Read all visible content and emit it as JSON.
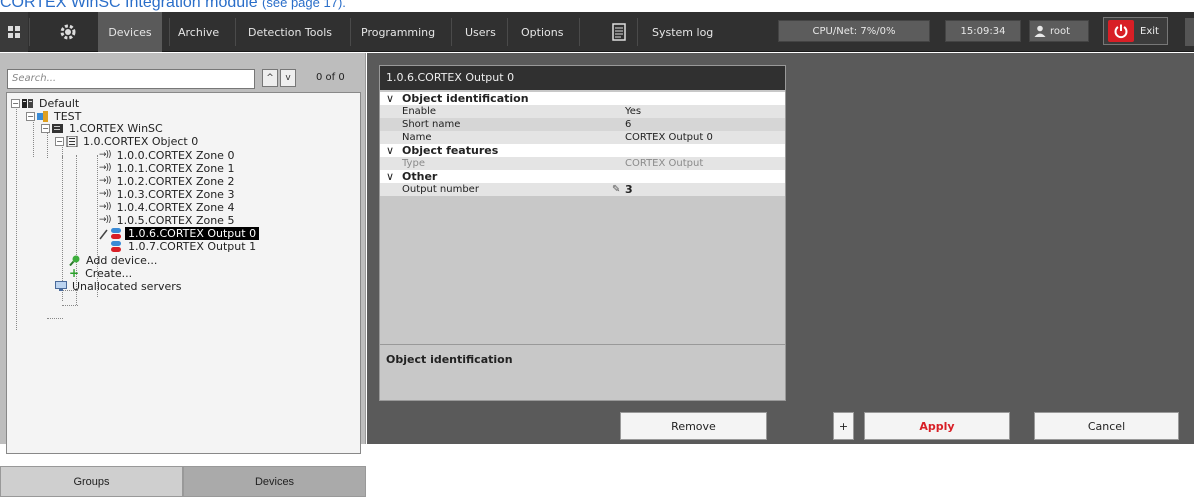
{
  "doc": {
    "caption": "CORTEX WinSC Integration module",
    "page_ref": "(see page 17)."
  },
  "topbar": {
    "tabs": [
      "Devices",
      "Archive",
      "Detection Tools",
      "Programming",
      "Users",
      "Options",
      "System log"
    ],
    "active_tab": "Devices",
    "cpu_net": "CPU/Net: 7%/0%",
    "clock": "15:09:34",
    "user": "root",
    "exit_label": "Exit",
    "colors": {
      "bar": "#303030",
      "exit": "#d81f26"
    }
  },
  "search": {
    "placeholder": "Search...",
    "count": "0 of 0",
    "up": "^",
    "down": "v"
  },
  "tree": {
    "root": "Default",
    "test": "TEST",
    "server": "1.CORTEX WinSC",
    "object": "1.0.CORTEX Object 0",
    "zones": [
      "1.0.0.CORTEX Zone 0",
      "1.0.1.CORTEX Zone 1",
      "1.0.2.CORTEX Zone 2",
      "1.0.3.CORTEX Zone 3",
      "1.0.4.CORTEX Zone 4",
      "1.0.5.CORTEX Zone 5"
    ],
    "outputs": [
      "1.0.6.CORTEX Output 0",
      "1.0.7.CORTEX Output 1"
    ],
    "add_device": "Add device...",
    "create": "Create...",
    "unallocated": "Unallocated servers",
    "zone_prefix": "→))"
  },
  "left_tabs": {
    "groups": "Groups",
    "devices": "Devices"
  },
  "props": {
    "title": "1.0.6.CORTEX Output 0",
    "groups": {
      "identification": "Object identification",
      "features": "Object features",
      "other": "Other"
    },
    "rows": {
      "enable": {
        "k": "Enable",
        "v": "Yes"
      },
      "short_name": {
        "k": "Short name",
        "v": "6"
      },
      "name": {
        "k": "Name",
        "v": "CORTEX Output 0"
      },
      "type": {
        "k": "Type",
        "v": "CORTEX Output"
      },
      "output_number": {
        "k": "Output number",
        "v": "3"
      }
    },
    "desc_title": "Object identification"
  },
  "buttons": {
    "remove": "Remove",
    "plus": "+",
    "apply": "Apply",
    "cancel": "Cancel"
  }
}
